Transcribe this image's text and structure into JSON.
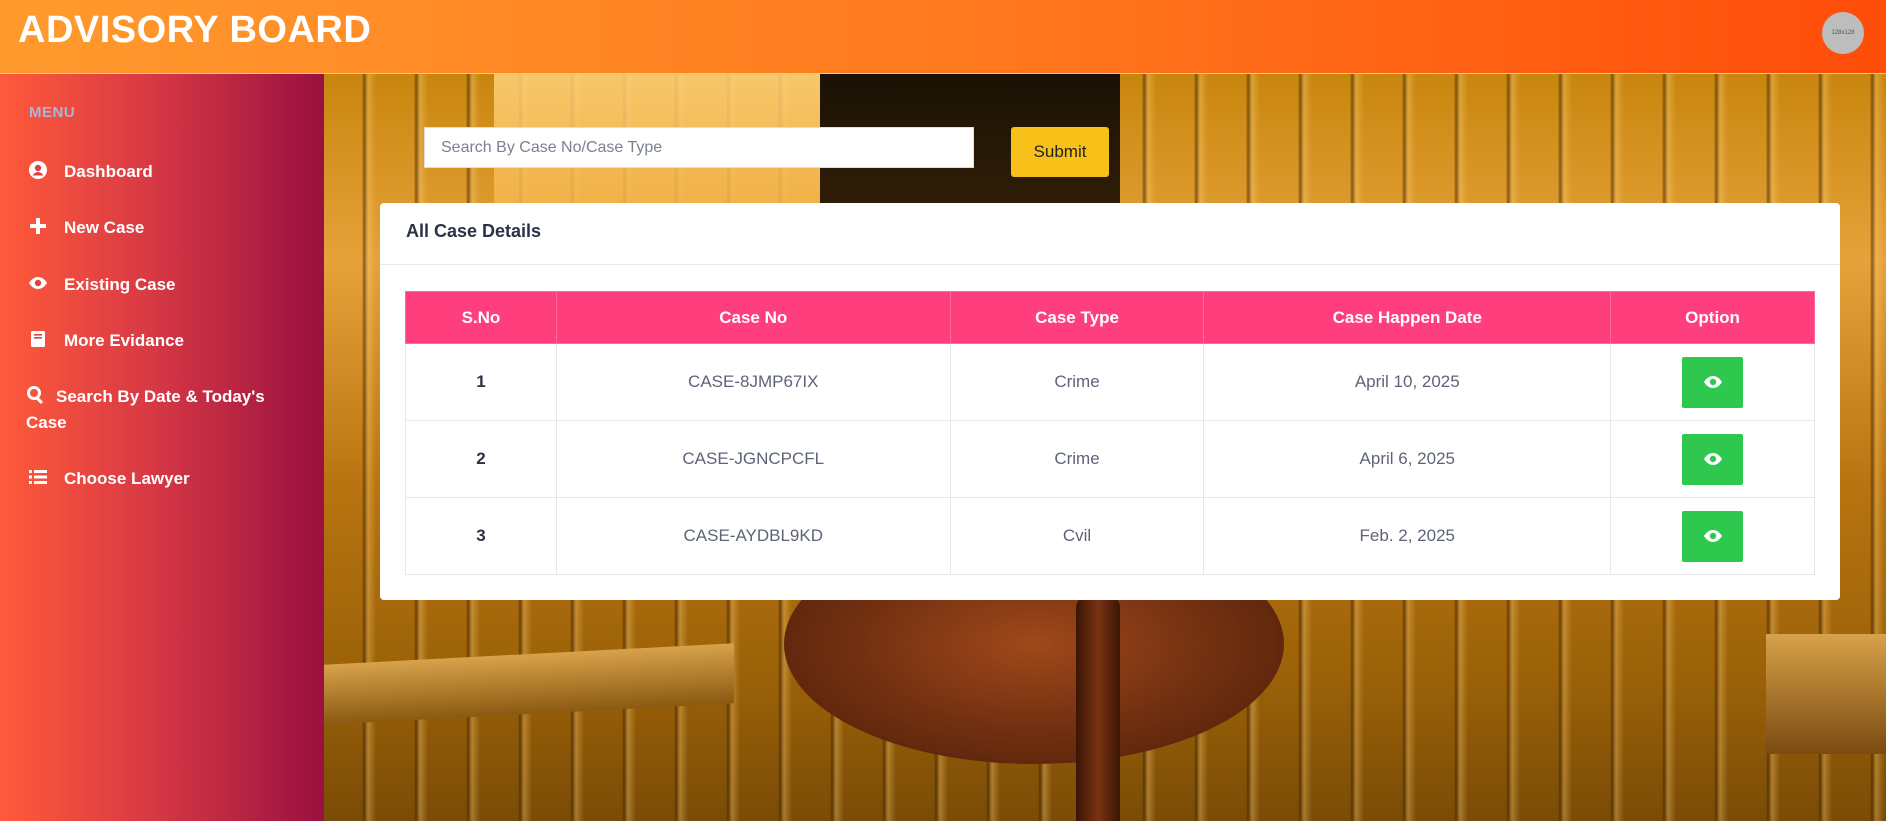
{
  "header": {
    "brand": "ADVISORY BOARD",
    "avatar_text": "128x128"
  },
  "sidebar": {
    "menu_title": "MENU",
    "items": [
      {
        "label": "Dashboard",
        "icon": "user-circle-icon"
      },
      {
        "label": "New Case",
        "icon": "plus-icon"
      },
      {
        "label": "Existing Case",
        "icon": "eye-icon"
      },
      {
        "label": "More Evidance",
        "icon": "book-icon"
      },
      {
        "label": "Search By Date & Today's Case",
        "icon": "search-icon"
      },
      {
        "label": "Choose Lawyer",
        "icon": "list-icon"
      }
    ]
  },
  "search": {
    "placeholder": "Search By Case No/Case Type",
    "value": "",
    "submit_label": "Submit"
  },
  "card": {
    "title": "All Case Details",
    "columns": [
      "S.No",
      "Case No",
      "Case Type",
      "Case Happen Date",
      "Option"
    ],
    "rows": [
      {
        "sno": "1",
        "case_no": "CASE-8JMP67IX",
        "case_type": "Crime",
        "date": "April 10, 2025",
        "option_icon": "eye-icon"
      },
      {
        "sno": "2",
        "case_no": "CASE-JGNCPCFL",
        "case_type": "Crime",
        "date": "April 6, 2025",
        "option_icon": "eye-icon"
      },
      {
        "sno": "3",
        "case_no": "CASE-AYDBL9KD",
        "case_type": "Cvil",
        "date": "Feb. 2, 2025",
        "option_icon": "eye-icon"
      }
    ]
  },
  "colors": {
    "topbar_start": "#ff9a2e",
    "topbar_end": "#ff4d0a",
    "sidebar_start": "#ff5a3a",
    "sidebar_end": "#9a1040",
    "table_header": "#ff3e7e",
    "submit_button": "#f7c11a",
    "view_button": "#2fc84f"
  }
}
